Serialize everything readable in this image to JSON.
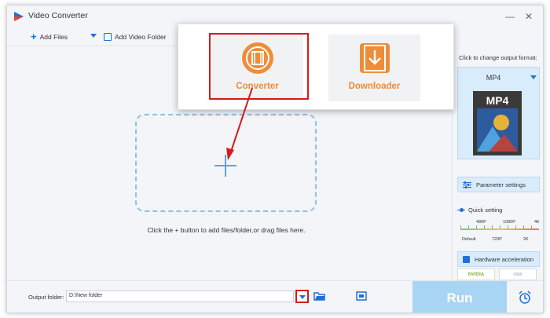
{
  "window": {
    "title": "Video Converter",
    "minimize": "—",
    "close": "✕"
  },
  "toolbar": {
    "add_files": "Add Files",
    "add_video_folder": "Add Video Folder"
  },
  "mode_popup": {
    "items": [
      {
        "label": "Converter",
        "icon": "film-icon",
        "selected": true
      },
      {
        "label": "Downloader",
        "icon": "download-icon",
        "selected": false
      }
    ]
  },
  "drop_zone": {
    "hint": "Click the + button to add files/folder,or drag files here."
  },
  "right_panel": {
    "format_label": "Click to change output format:",
    "format_name": "MP4",
    "format_icon_text": "MP4",
    "parameter_settings": "Parameter settings",
    "quick_setting": "Quick setting",
    "quality_top": [
      "480P",
      "1080P",
      "4K"
    ],
    "quality_bottom": [
      "Default",
      "720P",
      "2K"
    ],
    "hardware_acceleration": "Hardware acceleration",
    "nvidia_label": "NVIDIA",
    "intel_label": "intel"
  },
  "bottom": {
    "output_folder_label": "Output folder:",
    "output_folder_value": "D:\\New folder",
    "run_label": "Run"
  },
  "colors": {
    "accent": "#1e6fd8",
    "orange": "#ee8c3a",
    "highlight_red": "#d51b1b",
    "run_bg": "#a9d5f5"
  }
}
